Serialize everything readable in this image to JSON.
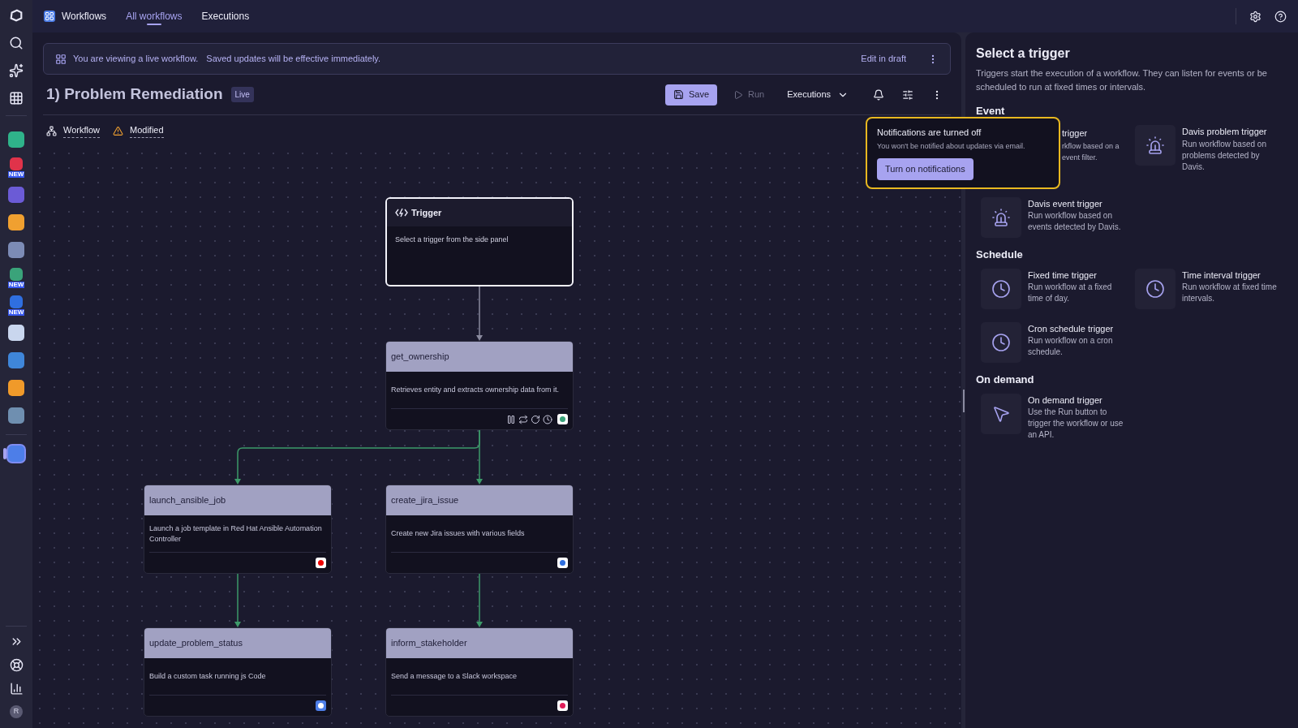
{
  "app": {
    "name": "Workflows",
    "nav": [
      {
        "label": "All workflows",
        "selected": true
      },
      {
        "label": "Executions",
        "selected": false
      }
    ]
  },
  "rail": {
    "top": [
      {
        "kind": "logo"
      },
      {
        "kind": "search"
      },
      {
        "kind": "sparkle"
      },
      {
        "kind": "apps"
      }
    ],
    "apps": [
      {
        "kind": "chart",
        "selected": false
      },
      {
        "kind": "alert",
        "badge": "NEW",
        "selected": false
      },
      {
        "kind": "cubes",
        "selected": false
      },
      {
        "kind": "shield",
        "selected": false
      },
      {
        "kind": "code",
        "selected": false
      },
      {
        "kind": "boxes",
        "badge": "NEW",
        "selected": false
      },
      {
        "kind": "helm",
        "badge": "NEW",
        "selected": false
      },
      {
        "kind": "cloud",
        "selected": false
      },
      {
        "kind": "cube",
        "selected": false
      },
      {
        "kind": "blocks",
        "selected": false
      },
      {
        "kind": "storage",
        "selected": false
      },
      {
        "kind": "workflows",
        "selected": true
      }
    ],
    "bottom": [
      {
        "kind": "expand"
      },
      {
        "kind": "help"
      },
      {
        "kind": "report"
      },
      {
        "kind": "avatar",
        "label": "R"
      }
    ]
  },
  "banner": {
    "message": "You are viewing a live workflow.",
    "detail": "Saved updates will be effective immediately.",
    "action": "Edit in draft"
  },
  "header": {
    "title": "1) Problem Remediation",
    "badge": "Live",
    "buttons": [
      {
        "kind": "save",
        "label": "Save",
        "disabled": false
      },
      {
        "kind": "run",
        "label": "Run",
        "disabled": true
      },
      {
        "kind": "dropdown",
        "label": "Executions",
        "disabled": false
      }
    ]
  },
  "subnav": [
    {
      "kind": "workflow",
      "label": "Workflow"
    },
    {
      "kind": "warning",
      "label": "Modified"
    }
  ],
  "popup": {
    "title": "Notifications are turned off",
    "text": "You won't be notified about updates via email.",
    "button": "Turn on notifications"
  },
  "workflow": {
    "kind": "trigger",
    "title": "Trigger",
    "description": "Select a trigger from the side panel",
    "children": [
      {
        "kind": "task",
        "edge": {
          "kind": "plain"
        },
        "title": "get_ownership",
        "description": "Retrieves entity and extracts ownership data from it.",
        "settings": [
          {
            "kind": "pause"
          },
          {
            "kind": "loop"
          },
          {
            "kind": "retry"
          },
          {
            "kind": "timeout"
          }
        ],
        "app": {
          "kind": "ownership"
        },
        "children": [
          {
            "kind": "task",
            "edge": {
              "kind": "success"
            },
            "title": "launch_ansible_job",
            "description": "Launch a job template in Red Hat Ansible Automation Controller",
            "app": {
              "kind": "ansible"
            },
            "children": [
              {
                "kind": "task",
                "edge": {
                  "kind": "success"
                },
                "title": "update_problem_status",
                "description": "Build a custom task running js Code",
                "app": {
                  "kind": "code"
                }
              }
            ]
          },
          {
            "kind": "task",
            "edge": {
              "kind": "success"
            },
            "title": "create_jira_issue",
            "description": "Create new Jira issues with various fields",
            "app": {
              "kind": "jira"
            },
            "children": [
              {
                "kind": "task",
                "edge": {
                  "kind": "success"
                },
                "title": "inform_stakeholder",
                "description": "Send a message to a Slack workspace",
                "app": {
                  "kind": "slack"
                }
              }
            ]
          }
        ]
      }
    ]
  },
  "panel": {
    "title": "Select a trigger",
    "description": "Triggers start the execution of a workflow. They can listen for events or be scheduled to run at fixed times or intervals.",
    "sections": [
      {
        "title": "Event",
        "triggers": [
          {
            "kind": "partial",
            "title": "trigger",
            "lines": [
              "rkflow based on a",
              "event filter."
            ]
          },
          {
            "kind": "alarm",
            "title": "Davis problem trigger",
            "description": "Run workflow based on problems detected by Davis."
          },
          {
            "kind": "alarm",
            "title": "Davis event trigger",
            "description": "Run workflow based on events detected by Davis."
          }
        ]
      },
      {
        "title": "Schedule",
        "triggers": [
          {
            "kind": "clock",
            "title": "Fixed time trigger",
            "description": "Run workflow at a fixed time of day."
          },
          {
            "kind": "clock",
            "title": "Time interval trigger",
            "description": "Run workflow at fixed time intervals."
          },
          {
            "kind": "clock",
            "title": "Cron schedule trigger",
            "description": "Run workflow on a cron schedule."
          }
        ]
      },
      {
        "title": "On demand",
        "triggers": [
          {
            "kind": "pointer",
            "title": "On demand trigger",
            "description": "Use the Run button to trigger the workflow or use an API."
          }
        ]
      }
    ]
  }
}
